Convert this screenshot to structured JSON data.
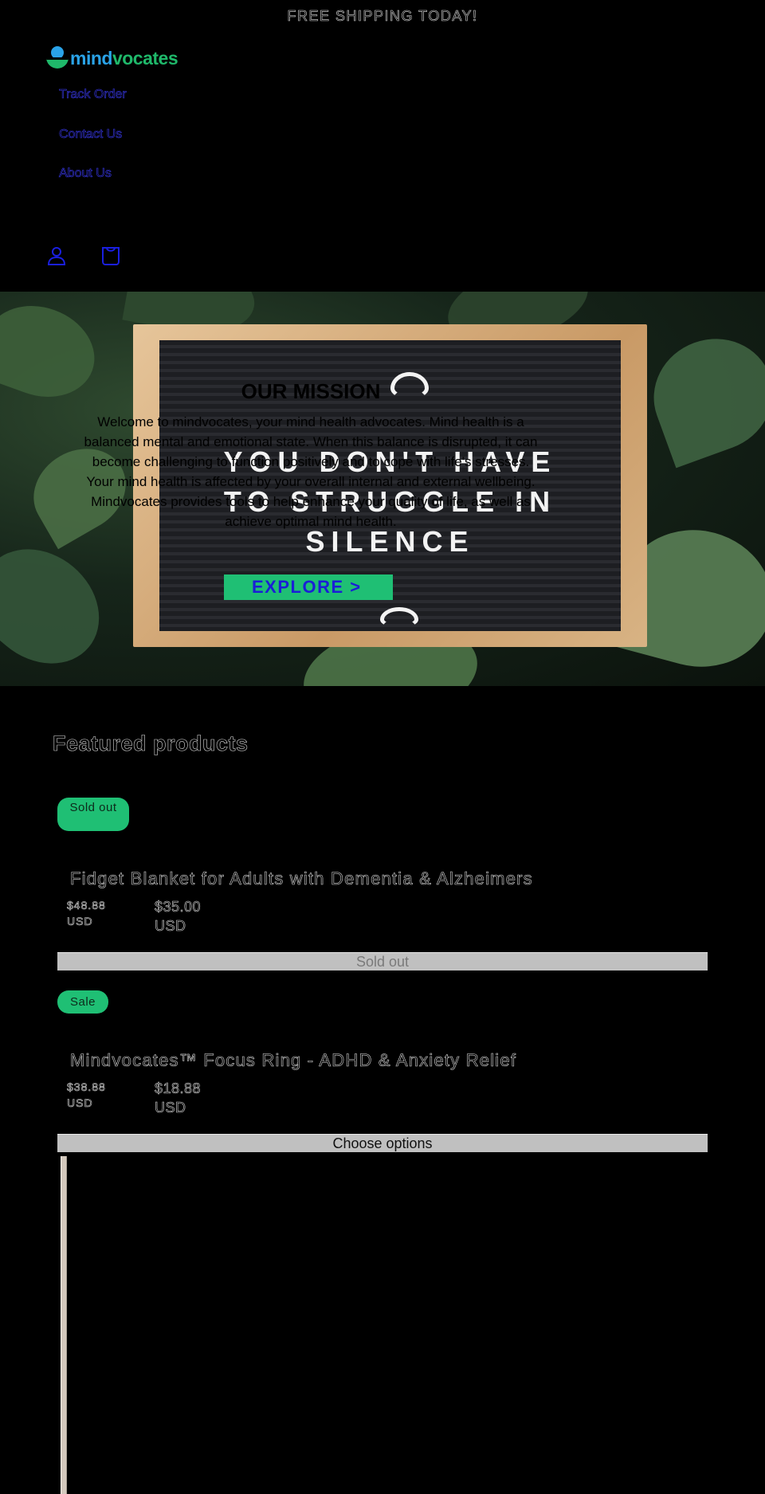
{
  "announcement": "FREE SHIPPING TODAY!",
  "brand": {
    "name_part1": "mind",
    "name_part2": "vocates",
    "colors": {
      "blue": "#2aa3e8",
      "green": "#1fb86a"
    }
  },
  "nav": {
    "items": [
      {
        "label": "Track Order"
      },
      {
        "label": "Contact Us"
      },
      {
        "label": "About Us"
      }
    ]
  },
  "header_icons": [
    {
      "name": "account-icon"
    },
    {
      "name": "cart-icon"
    }
  ],
  "hero": {
    "board_lines": [
      "YOU DON'T HAVE",
      "TO STRUGGLE IN",
      "SILENCE"
    ],
    "mission_title": "OUR MISSION",
    "mission_text": "Welcome to mindvocates, your mind health advocates. Mind health is a balanced mental and emotional state. When this balance is disrupted, it can become challenging to function positively and to cope with life's stresses. Your mind health is affected by your overall internal and external wellbeing. Mindvocates provides tools to help enhance your quality of life, as well as achieve optimal mind health.",
    "cta_label": "EXPLORE >",
    "cta_colors": {
      "background": "#1fbf74",
      "text": "#1a1fd6"
    }
  },
  "featured": {
    "title": "Featured products",
    "products": [
      {
        "badge": "Sold out",
        "title": "Fidget Blanket for Adults with Dementia & Alzheimers",
        "regular_price": "$48.88",
        "regular_currency": "USD",
        "sale_price": "$35.00",
        "sale_currency": "USD",
        "button_label": "Sold out"
      },
      {
        "badge": "Sale",
        "title": "Mindvocates™ Focus Ring - ADHD & Anxiety Relief",
        "regular_price": "$38.88",
        "regular_currency": "USD",
        "sale_price": "$18.88",
        "sale_currency": "USD",
        "button_label": "Choose options"
      }
    ]
  }
}
